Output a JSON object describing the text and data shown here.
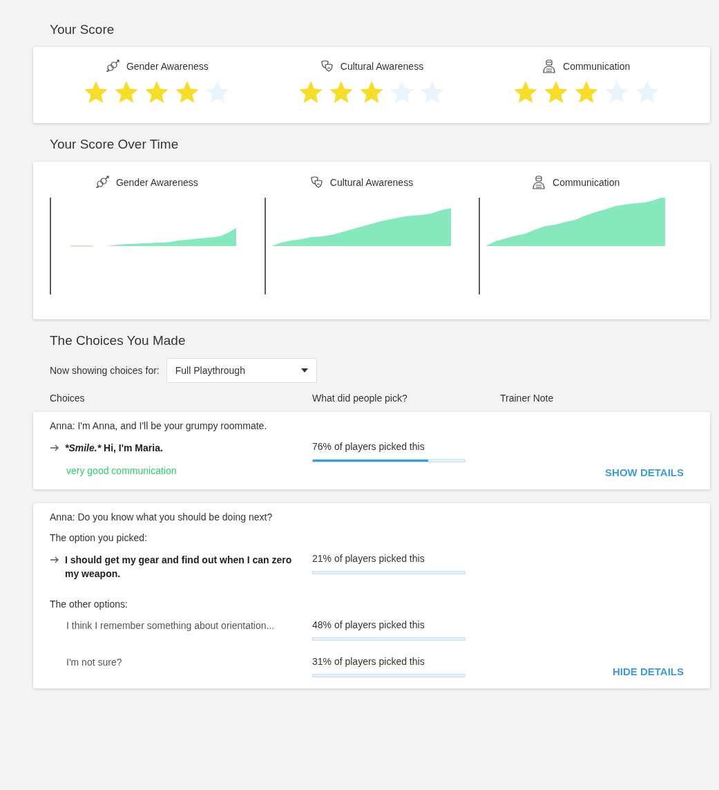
{
  "score": {
    "title": "Your Score",
    "skills": [
      {
        "kind": "gender",
        "label": "Gender Awareness",
        "stars": 4
      },
      {
        "kind": "culture",
        "label": "Cultural Awareness",
        "stars": 3
      },
      {
        "kind": "communication",
        "label": "Communication",
        "stars": 3
      }
    ]
  },
  "score_over_time": {
    "title": "Your Score Over Time",
    "charts": [
      {
        "kind": "gender",
        "label": "Gender Awareness"
      },
      {
        "kind": "culture",
        "label": "Cultural Awareness"
      },
      {
        "kind": "communication",
        "label": "Communication"
      }
    ]
  },
  "choices": {
    "title": "The Choices You Made",
    "filter_label": "Now showing choices for:",
    "filter_value": "Full Playthrough",
    "columns": [
      "Choices",
      "What did people pick?",
      "Trainer Note"
    ],
    "cards": [
      {
        "expanded": false,
        "prompt": "Anna: I'm Anna, and I'll be your grumpy roommate.",
        "picked": {
          "emote": "*Smile.*",
          "text": "Hi, I'm Maria.",
          "percent": "76% of players picked this",
          "level": 0.76
        },
        "feedback": "very good communication",
        "toggle": "SHOW DETAILS"
      },
      {
        "expanded": true,
        "prompt": "Anna: Do you know what you should be doing next?",
        "picked_label": "The option you picked:",
        "picked": {
          "text": "I should get my gear and find out when I can zero my weapon.",
          "percent": "21% of players picked this"
        },
        "others_label": "The other options:",
        "others": [
          {
            "text": "I think I remember something about orientation...",
            "percent": "48% of players picked this"
          },
          {
            "text": "I'm not sure?",
            "percent": "31% of players picked this"
          }
        ],
        "toggle": "HIDE DETAILS"
      }
    ]
  }
}
